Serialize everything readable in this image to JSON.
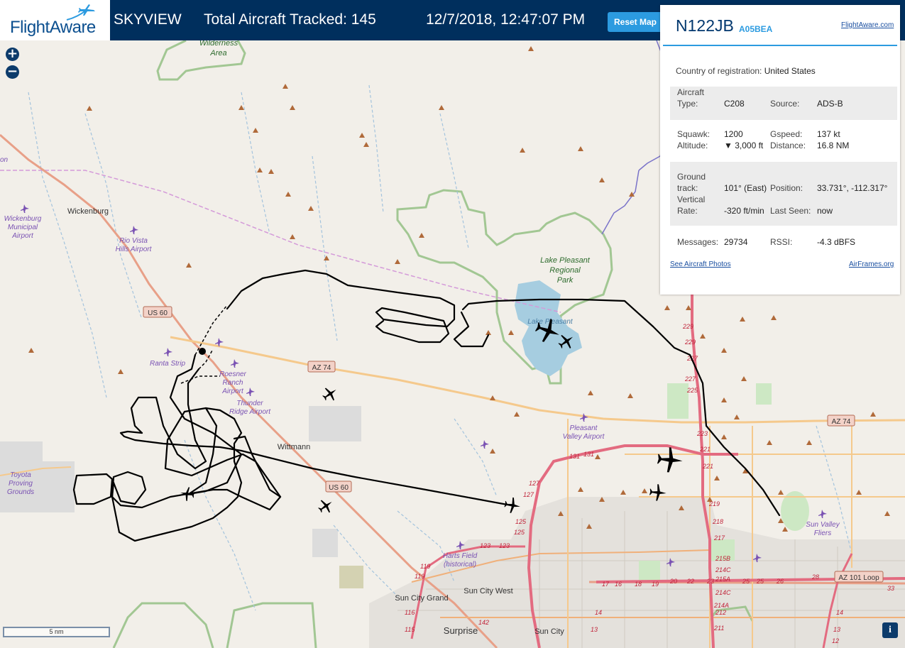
{
  "header": {
    "logo": "FlightAware",
    "app_name": "SKYVIEW",
    "aircraft_tracked": "Total Aircraft Tracked: 145",
    "datetime": "12/7/2018, 12:47:07 PM",
    "reset_label": "Reset Map"
  },
  "map_controls": {
    "zoom_in": "+",
    "zoom_out": "−",
    "scale_label": "5 nm",
    "info": "i"
  },
  "map_labels": {
    "wilderness": "Wilderness",
    "area": "Area",
    "wickenburg": "Wickenburg",
    "wickenburg_airport_1": "Wickenburg",
    "wickenburg_airport_2": "Municipal",
    "wickenburg_airport_3": "Airport",
    "rio_vista_1": "Rio Vista",
    "rio_vista_2": "Hills Airport",
    "us60_a": "US 60",
    "us60_b": "US 60",
    "az74_a": "AZ 74",
    "az74_b": "AZ 74",
    "az101": "AZ 101 Loop",
    "ranta": "Ranta Strip",
    "roesner_1": "Roesner",
    "roesner_2": "Ranch",
    "roesner_3": "Airport",
    "thunder_1": "Thunder",
    "thunder_2": "Ridge Airport",
    "wittmann": "Wittmann",
    "toyota_1": "Toyota",
    "toyota_2": "Proving",
    "toyota_3": "Grounds",
    "lake_1": "Lake Pleasant",
    "lake_2": "Regional",
    "lake_3": "Park",
    "lake_water": "Lake Pleasant",
    "pleasant_valley_1": "Pleasant",
    "pleasant_valley_2": "Valley Airport",
    "harts_1": "Harts Field",
    "harts_2": "(historical)",
    "sun_valley_1": "Sun Valley",
    "sun_valley_2": "Fliers",
    "sun_city_grand": "Sun City Grand",
    "sun_city_west": "Sun City West",
    "surprise": "Surprise",
    "sun_city": "Sun City",
    "on": "on"
  },
  "aircraft_panel": {
    "callsign": "N122JB",
    "icao": "A05BEA",
    "flightaware_link": "FlightAware.com",
    "country_label": "Country of registration:",
    "country_value": "United States",
    "aircraft_type_label_1": "Aircraft",
    "aircraft_type_label_2": "Type:",
    "aircraft_type": "C208",
    "source_label": "Source:",
    "source": "ADS-B",
    "squawk_label": "Squawk:",
    "squawk": "1200",
    "gspeed_label": "Gspeed:",
    "gspeed": "137 kt",
    "altitude_label": "Altitude:",
    "altitude": "▼ 3,000 ft",
    "distance_label": "Distance:",
    "distance": "16.8 NM",
    "ground_track_label_1": "Ground",
    "ground_track_label_2": "track:",
    "ground_track": "101° (East)",
    "position_label": "Position:",
    "position": "33.731°, -112.317°",
    "vertical_rate_label_1": "Vertical",
    "vertical_rate_label_2": "Rate:",
    "vertical_rate": "-320 ft/min",
    "last_seen_label": "Last Seen:",
    "last_seen": "now",
    "messages_label": "Messages:",
    "messages": "29734",
    "rssi_label": "RSSI:",
    "rssi": "-4.3 dBFS",
    "photos_link": "See Aircraft Photos",
    "airframes_link": "AirFrames.org"
  },
  "colors": {
    "header_bg": "#002f5d",
    "accent": "#2c9be0",
    "map_bg": "#f2efe9",
    "track": "#000000"
  }
}
